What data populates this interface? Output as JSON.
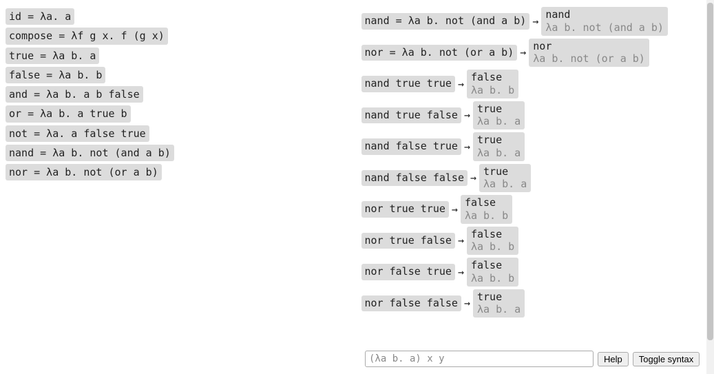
{
  "definitions": [
    "id = λa. a",
    "compose = λf g x. f (g x)",
    "true = λa b. a",
    "false = λa b. b",
    "and = λa b. a b false",
    "or = λa b. a true b",
    "not = λa. a false true",
    "nand = λa b. not (and a b)",
    "nor = λa b. not (or a b)"
  ],
  "evaluations": [
    {
      "expr": "nand = λa b. not (and a b)",
      "result_name": "nand",
      "result_lambda": "λa b. not (and a b)"
    },
    {
      "expr": "nor = λa b. not (or a b)",
      "result_name": "nor",
      "result_lambda": "λa b. not (or a b)"
    },
    {
      "expr": "nand true true",
      "result_name": "false",
      "result_lambda": "λa b. b"
    },
    {
      "expr": "nand true false",
      "result_name": "true",
      "result_lambda": "λa b. a"
    },
    {
      "expr": "nand false true",
      "result_name": "true",
      "result_lambda": "λa b. a"
    },
    {
      "expr": "nand false false",
      "result_name": "true",
      "result_lambda": "λa b. a"
    },
    {
      "expr": "nor true true",
      "result_name": "false",
      "result_lambda": "λa b. b"
    },
    {
      "expr": "nor true false",
      "result_name": "false",
      "result_lambda": "λa b. b"
    },
    {
      "expr": "nor false true",
      "result_name": "false",
      "result_lambda": "λa b. b"
    },
    {
      "expr": "nor false false",
      "result_name": "true",
      "result_lambda": "λa b. a"
    }
  ],
  "input": {
    "placeholder": "(λa b. a) x y"
  },
  "buttons": {
    "help": "Help",
    "toggle": "Toggle syntax"
  },
  "arrow": "→"
}
